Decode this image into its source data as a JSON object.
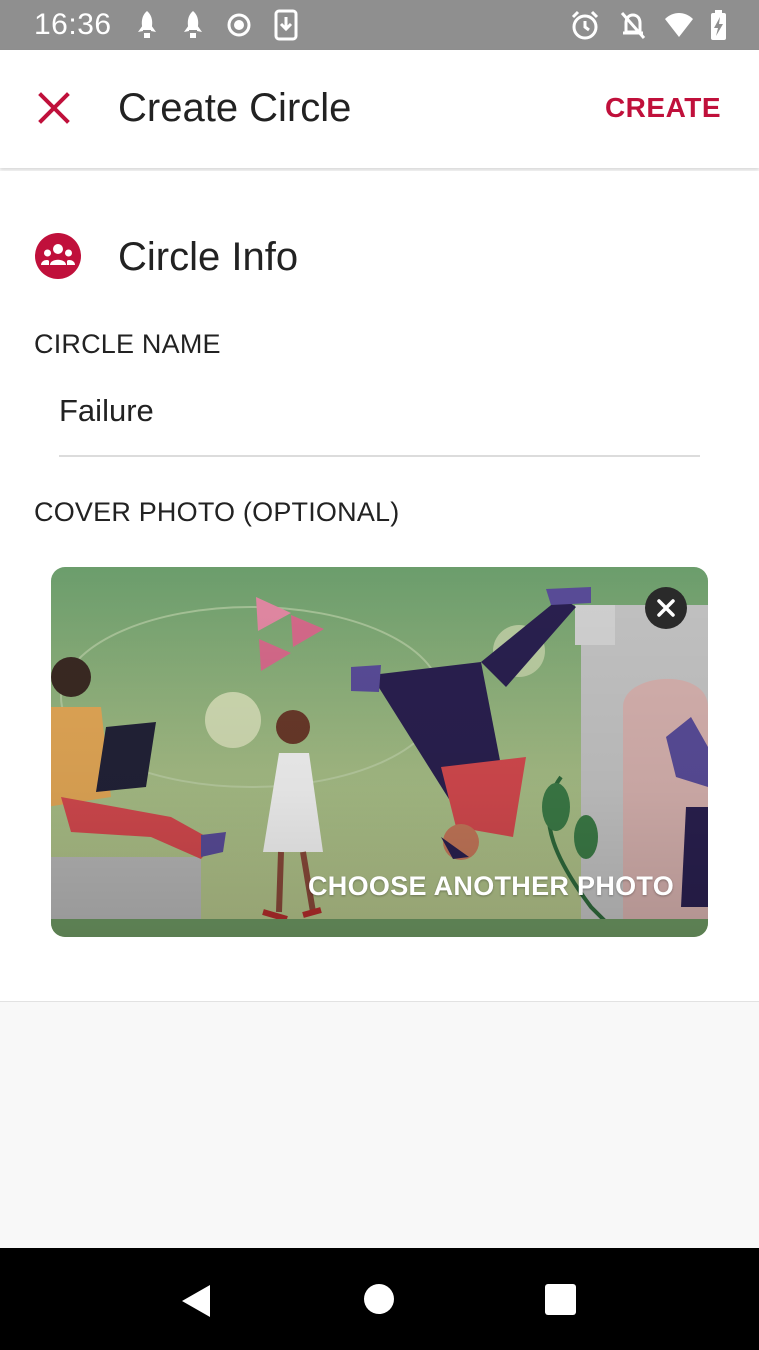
{
  "status_bar": {
    "time": "16:36",
    "left_icons": [
      "rocket-icon",
      "rocket-icon",
      "record-icon",
      "download-icon"
    ],
    "right_icons": [
      "alarm-icon",
      "notifications-off-icon",
      "wifi-icon",
      "battery-icon"
    ]
  },
  "app_bar": {
    "close_icon": "close-icon",
    "title": "Create Circle",
    "create_label": "CREATE",
    "accent_color": "#c0103b"
  },
  "circle_info": {
    "icon": "group-icon",
    "heading": "Circle Info",
    "name_label": "CIRCLE NAME",
    "name_value": "Failure",
    "cover_label": "COVER PHOTO (OPTIONAL)",
    "cover_action": "CHOOSE ANOTHER PHOTO",
    "remove_photo_icon": "close-icon"
  },
  "nav_bar": {
    "back_icon": "back-icon",
    "home_icon": "home-icon",
    "recents_icon": "recents-icon"
  }
}
